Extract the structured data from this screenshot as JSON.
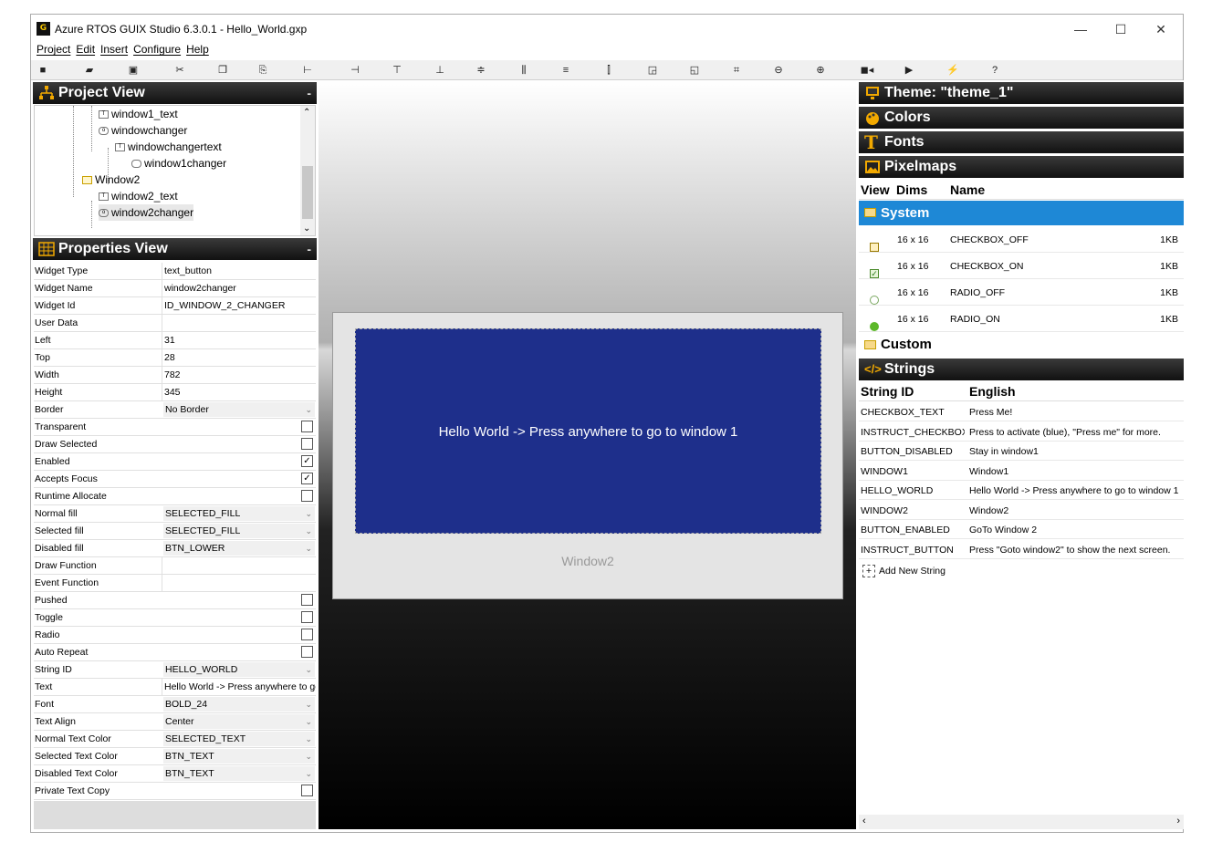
{
  "app": {
    "logo": "G",
    "title": "Azure RTOS GUIX Studio 6.3.0.1 - Hello_World.gxp"
  },
  "window_controls": {
    "minimize": "—",
    "maximize": "☐",
    "close": "✕"
  },
  "menu": [
    "Project",
    "Edit",
    "Insert",
    "Configure",
    "Help"
  ],
  "project_view": {
    "title": "Project View",
    "nodes": [
      {
        "label": "window1_text",
        "icon": "T"
      },
      {
        "label": "windowchanger",
        "icon": "o"
      },
      {
        "label": "windowchangertext",
        "icon": "T"
      },
      {
        "label": "window1changer",
        "icon": ""
      },
      {
        "label": "Window2",
        "icon": ""
      },
      {
        "label": "window2_text",
        "icon": "T"
      },
      {
        "label": "window2changer",
        "icon": "o"
      }
    ]
  },
  "properties_view": {
    "title": "Properties View",
    "rows": [
      {
        "label": "Widget Type",
        "value": "text_button",
        "kind": "text"
      },
      {
        "label": "Widget Name",
        "value": "window2changer",
        "kind": "text"
      },
      {
        "label": "Widget Id",
        "value": "ID_WINDOW_2_CHANGER",
        "kind": "text"
      },
      {
        "label": "User Data",
        "value": "",
        "kind": "text"
      },
      {
        "label": "Left",
        "value": "31",
        "kind": "text"
      },
      {
        "label": "Top",
        "value": "28",
        "kind": "text"
      },
      {
        "label": "Width",
        "value": "782",
        "kind": "text"
      },
      {
        "label": "Height",
        "value": "345",
        "kind": "text"
      },
      {
        "label": "Border",
        "value": "No Border",
        "kind": "combo"
      },
      {
        "label": "Transparent",
        "value": "",
        "kind": "check",
        "checked": false
      },
      {
        "label": "Draw Selected",
        "value": "",
        "kind": "check",
        "checked": false
      },
      {
        "label": "Enabled",
        "value": "",
        "kind": "check",
        "checked": true
      },
      {
        "label": "Accepts Focus",
        "value": "",
        "kind": "check",
        "checked": true
      },
      {
        "label": "Runtime Allocate",
        "value": "",
        "kind": "check",
        "checked": false
      },
      {
        "label": "Normal fill",
        "value": "SELECTED_FILL",
        "kind": "combo"
      },
      {
        "label": "Selected fill",
        "value": "SELECTED_FILL",
        "kind": "combo"
      },
      {
        "label": "Disabled fill",
        "value": "BTN_LOWER",
        "kind": "combo"
      },
      {
        "label": "Draw Function",
        "value": "",
        "kind": "text"
      },
      {
        "label": "Event Function",
        "value": "",
        "kind": "text"
      },
      {
        "label": "Pushed",
        "value": "",
        "kind": "check",
        "checked": false
      },
      {
        "label": "Toggle",
        "value": "",
        "kind": "check",
        "checked": false
      },
      {
        "label": "Radio",
        "value": "",
        "kind": "check",
        "checked": false
      },
      {
        "label": "Auto Repeat",
        "value": "",
        "kind": "check",
        "checked": false
      },
      {
        "label": "String ID",
        "value": "HELLO_WORLD",
        "kind": "combo"
      },
      {
        "label": "Text",
        "value": "Hello World -> Press anywhere to go",
        "kind": "text"
      },
      {
        "label": "Font",
        "value": "BOLD_24",
        "kind": "combo"
      },
      {
        "label": "Text Align",
        "value": "Center",
        "kind": "combo"
      },
      {
        "label": "Normal Text Color",
        "value": "SELECTED_TEXT",
        "kind": "combo"
      },
      {
        "label": "Selected Text Color",
        "value": "BTN_TEXT",
        "kind": "combo"
      },
      {
        "label": "Disabled Text Color",
        "value": "BTN_TEXT",
        "kind": "combo"
      },
      {
        "label": "Private Text Copy",
        "value": "",
        "kind": "check",
        "checked": false
      }
    ]
  },
  "canvas": {
    "button_text": "Hello World -> Press anywhere to go to window 1",
    "window_label": "Window2"
  },
  "resources": {
    "theme": "Theme: \"theme_1\"",
    "colors": "Colors",
    "fonts": "Fonts",
    "pixelmaps": "Pixelmaps",
    "pix_headers": [
      "View",
      "Dims",
      "Name"
    ],
    "system_folder": "System",
    "pixmaps": [
      {
        "icon": "checkbox-off",
        "dims": "16 x 16",
        "name": "CHECKBOX_OFF",
        "size": "1KB"
      },
      {
        "icon": "checkbox-on",
        "dims": "16 x 16",
        "name": "CHECKBOX_ON",
        "size": "1KB"
      },
      {
        "icon": "radio-off",
        "dims": "16 x 16",
        "name": "RADIO_OFF",
        "size": "1KB"
      },
      {
        "icon": "radio-on",
        "dims": "16 x 16",
        "name": "RADIO_ON",
        "size": "1KB"
      }
    ],
    "custom_folder": "Custom",
    "strings_title": "Strings",
    "string_headers": [
      "String ID",
      "English"
    ],
    "strings": [
      {
        "id": "CHECKBOX_TEXT",
        "en": "Press Me!"
      },
      {
        "id": "INSTRUCT_CHECKBOX",
        "en": "Press to activate (blue), \"Press me\" for more."
      },
      {
        "id": "BUTTON_DISABLED",
        "en": "Stay in window1"
      },
      {
        "id": "WINDOW1",
        "en": "Window1"
      },
      {
        "id": "HELLO_WORLD",
        "en": "Hello World -> Press anywhere to go to window 1"
      },
      {
        "id": "WINDOW2",
        "en": "Window2"
      },
      {
        "id": "BUTTON_ENABLED",
        "en": "GoTo Window 2"
      },
      {
        "id": "INSTRUCT_BUTTON",
        "en": "Press \"Goto window2\" to show the next screen."
      }
    ],
    "add_string": "Add New String"
  },
  "colors": {
    "selected_fill": "#1e2f8b",
    "highlight": "#1e88d6",
    "panel_head": "#222222"
  }
}
